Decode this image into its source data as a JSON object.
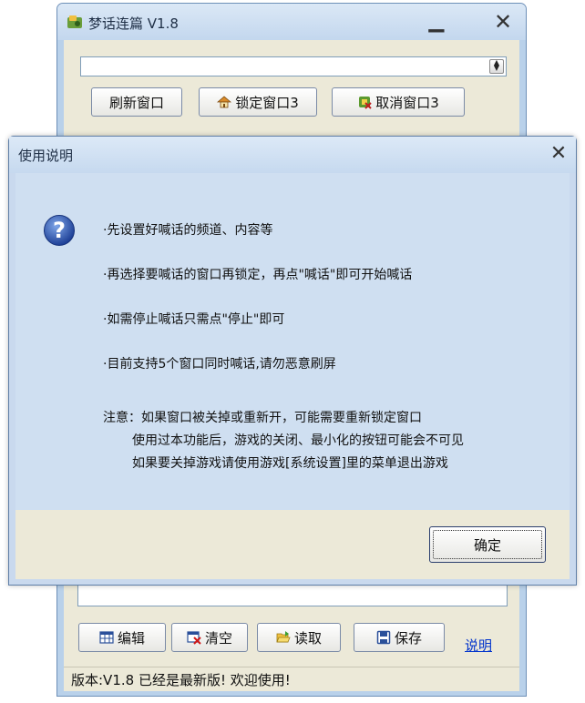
{
  "main": {
    "title": "梦话连篇 V1.8",
    "combo_value": "",
    "buttons": {
      "refresh": "刷新窗口",
      "lock": "锁定窗口3",
      "cancel": "取消窗口3"
    },
    "bottom_buttons": {
      "edit": "编辑",
      "clear": "清空",
      "load": "读取",
      "save": "保存"
    },
    "help_link": "说明",
    "status": "版本:V1.8 已经是最新版! 欢迎使用!"
  },
  "dialog": {
    "title": "使用说明",
    "lines": [
      "·先设置好喊话的频道、内容等",
      "·再选择要喊话的窗口再锁定，再点\"喊话\"即可开始喊话",
      "·如需停止喊话只需点\"停止\"即可",
      "·目前支持5个窗口同时喊话,请勿恶意刷屏"
    ],
    "notes": [
      "注意：如果窗口被关掉或重新开，可能需要重新锁定窗口",
      "使用过本功能后，游戏的关闭、最小化的按钮可能会不可见",
      "如果要关掉游戏请使用游戏[系统设置]里的菜单退出游戏"
    ],
    "ok_label": "确定"
  },
  "icons": {
    "app": "app-icon",
    "home": "home-icon",
    "cancel": "cancel-icon",
    "edit": "grid-icon",
    "clear": "clear-icon",
    "load": "folder-open-icon",
    "save": "floppy-icon",
    "question": "question-icon"
  },
  "colors": {
    "window_frame": "#b9d1ea",
    "client": "#ece9d8",
    "dialog_body": "#cfdff1",
    "link": "#0033cc"
  }
}
